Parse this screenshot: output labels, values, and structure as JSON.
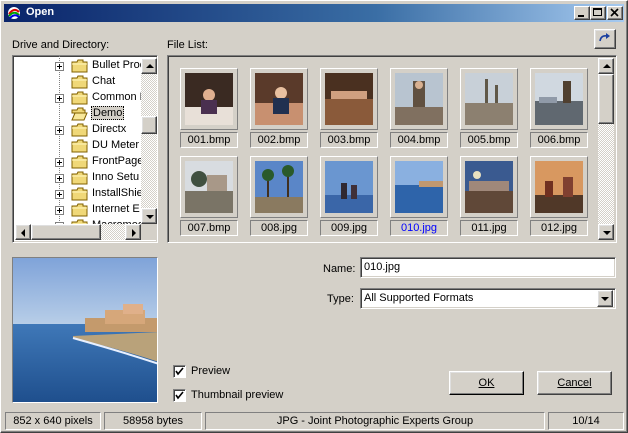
{
  "window": {
    "title": "Open"
  },
  "labels": {
    "drive_directory": "Drive and Directory:",
    "file_list": "File List:",
    "name": "Name:",
    "type": "Type:"
  },
  "tree": {
    "items": [
      {
        "label": "Bullet Proo",
        "expandable": true
      },
      {
        "label": "Chat",
        "expandable": false
      },
      {
        "label": "Common F",
        "expandable": true
      },
      {
        "label": "Demo",
        "expandable": false,
        "selected": true
      },
      {
        "label": "Directx",
        "expandable": true
      },
      {
        "label": "DU Meter",
        "expandable": false
      },
      {
        "label": "FrontPage",
        "expandable": true
      },
      {
        "label": "Inno Setu",
        "expandable": true
      },
      {
        "label": "InstallShie",
        "expandable": true
      },
      {
        "label": "Internet E",
        "expandable": true
      },
      {
        "label": "Macromed",
        "expandable": true
      }
    ]
  },
  "files": [
    {
      "name": "001.bmp"
    },
    {
      "name": "002.bmp"
    },
    {
      "name": "003.bmp"
    },
    {
      "name": "004.bmp"
    },
    {
      "name": "005.bmp"
    },
    {
      "name": "006.bmp"
    },
    {
      "name": "007.bmp"
    },
    {
      "name": "008.jpg"
    },
    {
      "name": "009.jpg"
    },
    {
      "name": "010.jpg",
      "selected": true
    },
    {
      "name": "011.jpg"
    },
    {
      "name": "012.jpg"
    }
  ],
  "form": {
    "name_value": "010.jpg",
    "type_value": "All Supported Formats"
  },
  "options": {
    "preview_label": "Preview",
    "preview_checked": true,
    "thumbnail_label": "Thumbnail preview",
    "thumbnail_checked": true
  },
  "buttons": {
    "ok": "OK",
    "cancel": "Cancel"
  },
  "status": {
    "dimensions": "852 x 640 pixels",
    "size": "58958 bytes",
    "format": "JPG - Joint Photographic Experts Group",
    "position": "10/14"
  },
  "icons": {
    "app": "open-dialog-icon",
    "refresh": "refresh-icon",
    "folder": "folder-icon"
  },
  "colors": {
    "face": "#d4d0c8",
    "title_start": "#0a246a",
    "title_end": "#a6caf0",
    "selected_text": "#0000ff"
  }
}
